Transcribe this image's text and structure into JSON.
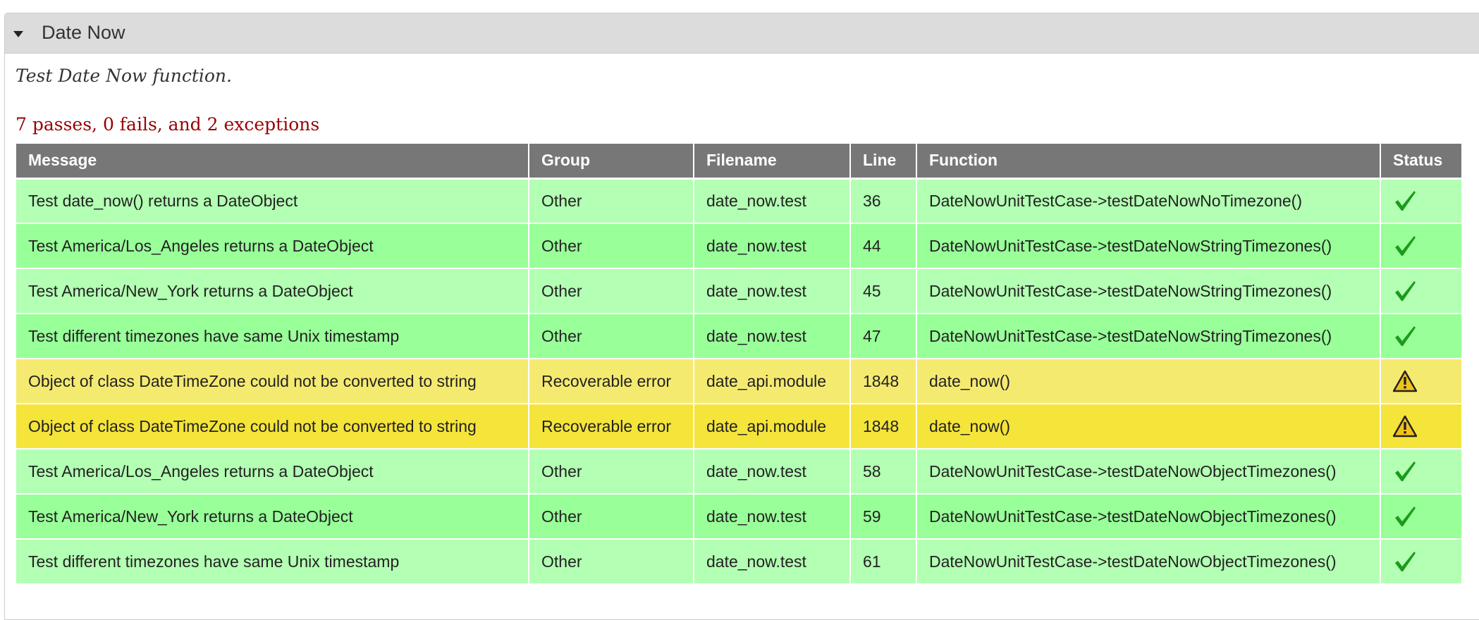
{
  "fieldset": {
    "title": "Date Now",
    "description": "Test Date Now function.",
    "summary": "7 passes, 0 fails, and 2 exceptions"
  },
  "table": {
    "headers": [
      "Message",
      "Group",
      "Filename",
      "Line",
      "Function",
      "Status"
    ],
    "rows": [
      {
        "status": "pass",
        "status_icon": "checkmark-icon",
        "message": "Test date_now() returns a DateObject",
        "group": "Other",
        "filename": "date_now.test",
        "line": "36",
        "function": "DateNowUnitTestCase->testDateNowNoTimezone()"
      },
      {
        "status": "pass",
        "status_icon": "checkmark-icon",
        "message": "Test America/Los_Angeles returns a DateObject",
        "group": "Other",
        "filename": "date_now.test",
        "line": "44",
        "function": "DateNowUnitTestCase->testDateNowStringTimezones()"
      },
      {
        "status": "pass",
        "status_icon": "checkmark-icon",
        "message": "Test America/New_York returns a DateObject",
        "group": "Other",
        "filename": "date_now.test",
        "line": "45",
        "function": "DateNowUnitTestCase->testDateNowStringTimezones()"
      },
      {
        "status": "pass",
        "status_icon": "checkmark-icon",
        "message": "Test different timezones have same Unix timestamp",
        "group": "Other",
        "filename": "date_now.test",
        "line": "47",
        "function": "DateNowUnitTestCase->testDateNowStringTimezones()"
      },
      {
        "status": "exception",
        "status_icon": "warning-icon",
        "message": "Object of class DateTimeZone could not be converted to string",
        "group": "Recoverable error",
        "filename": "date_api.module",
        "line": "1848",
        "function": "date_now()"
      },
      {
        "status": "exception",
        "status_icon": "warning-icon",
        "message": "Object of class DateTimeZone could not be converted to string",
        "group": "Recoverable error",
        "filename": "date_api.module",
        "line": "1848",
        "function": "date_now()"
      },
      {
        "status": "pass",
        "status_icon": "checkmark-icon",
        "message": "Test America/Los_Angeles returns a DateObject",
        "group": "Other",
        "filename": "date_now.test",
        "line": "58",
        "function": "DateNowUnitTestCase->testDateNowObjectTimezones()"
      },
      {
        "status": "pass",
        "status_icon": "checkmark-icon",
        "message": "Test America/New_York returns a DateObject",
        "group": "Other",
        "filename": "date_now.test",
        "line": "59",
        "function": "DateNowUnitTestCase->testDateNowObjectTimezones()"
      },
      {
        "status": "pass",
        "status_icon": "checkmark-icon",
        "message": "Test different timezones have same Unix timestamp",
        "group": "Other",
        "filename": "date_now.test",
        "line": "61",
        "function": "DateNowUnitTestCase->testDateNowObjectTimezones()"
      }
    ]
  },
  "colors": {
    "header_bg": "#777777",
    "pass_odd": "#b3ffb3",
    "pass_even": "#99ff99",
    "exception_odd": "#f5ea70",
    "exception_even": "#f5e43a",
    "summary_text": "#990000",
    "check_icon": "#1a9c1a"
  }
}
